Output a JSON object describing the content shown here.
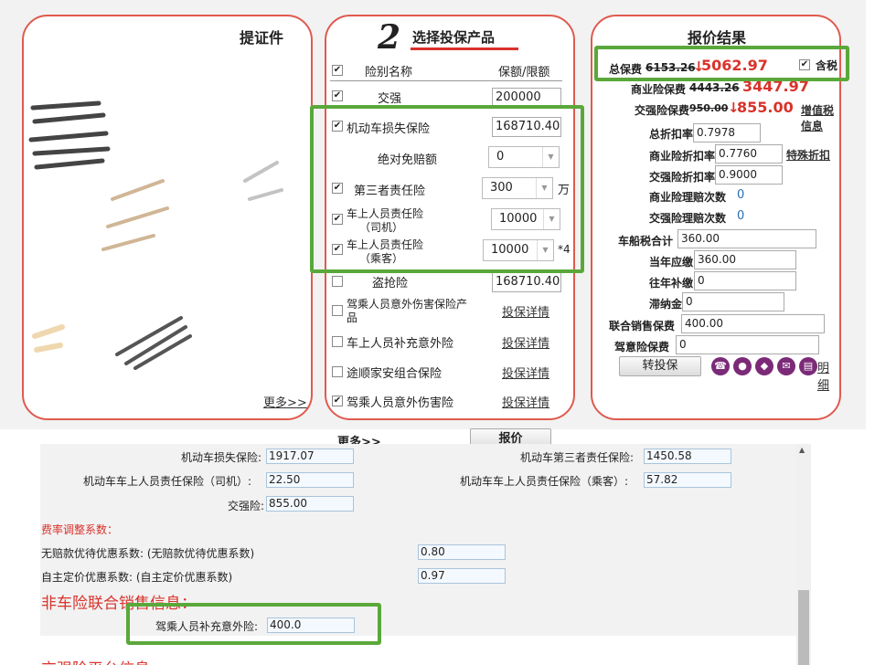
{
  "left_panel": {
    "title_fragment": "提证件",
    "more_link": "更多>>"
  },
  "middle_panel": {
    "step_number": "2",
    "title": "选择投保产品",
    "col_name": "险别名称",
    "col_amount": "保额/限额",
    "rows": [
      {
        "label": "交强",
        "value": "200000",
        "checked": true
      },
      {
        "label": "机动车损失保险",
        "value": "168710.40",
        "checked": true
      },
      {
        "label": "绝对免赔额",
        "value": "0"
      },
      {
        "label": "第三者责任险",
        "value": "300",
        "unit": "万",
        "checked": true
      },
      {
        "label": "车上人员责任险",
        "sub": "（司机）",
        "value": "10000",
        "checked": true
      },
      {
        "label": "车上人员责任险",
        "sub": "（乘客）",
        "value": "10000",
        "suffix": "*4",
        "checked": true
      },
      {
        "label": "盗抢险",
        "value": "168710.40",
        "checked": false
      },
      {
        "label": "驾乘人员意外伤害保险产",
        "label2": "品",
        "link": "投保详情",
        "checked": false
      },
      {
        "label": "车上人员补充意外险",
        "link": "投保详情",
        "checked": false
      },
      {
        "label": "途顺家安组合保险",
        "link": "投保详情",
        "checked": false
      },
      {
        "label": "驾乘人员意外伤害险",
        "link": "投保详情",
        "checked": true
      }
    ],
    "more_link": "更多>>",
    "quote_button": "报价"
  },
  "right_panel": {
    "title": "报价结果",
    "total_label": "总保费",
    "total_old": "6153.26",
    "total_new": "5062.97",
    "tax_label": "含税",
    "biz_label": "商业险保费",
    "biz_old": "4443.26",
    "biz_new": "3447.97",
    "cti_label": "交强险保费",
    "cti_old": "950.00",
    "cti_new": "855.00",
    "vat_link": "增值税信息",
    "total_discount_label": "总折扣率",
    "total_discount": "0.7978",
    "biz_discount_label": "商业险折扣率",
    "biz_discount": "0.7760",
    "special_discount_link": "特殊折扣",
    "cti_discount_label": "交强险折扣率",
    "cti_discount": "0.9000",
    "biz_claims_label": "商业险理赔次数",
    "biz_claims": "0",
    "cti_claims_label": "交强险理赔次数",
    "cti_claims": "0",
    "vessel_tax_label": "车船税合计",
    "vessel_tax": "360.00",
    "current_due_label": "当年应缴",
    "current_due": "360.00",
    "past_due_label": "往年补缴",
    "past_due": "0",
    "late_fee_label": "滞纳金",
    "late_fee": "0",
    "joint_sale_label": "联合销售保费",
    "joint_sale": "400.00",
    "driver_acc_label": "驾意险保费",
    "driver_acc": "0",
    "transfer_button": "转投保",
    "detail_link": "明细"
  },
  "detail": {
    "rows": [
      {
        "label": "机动车损失保险:",
        "value": "1917.07",
        "label_r": "机动车第三者责任保险:",
        "value_r": "1450.58"
      },
      {
        "label": "机动车车上人员责任保险（司机）:",
        "value": "22.50",
        "label_r": "机动车车上人员责任保险（乘客）:",
        "value_r": "57.82"
      },
      {
        "label": "交强险:",
        "value": "855.00"
      }
    ],
    "rate_title": "费率调整系数：",
    "rate_rows": [
      {
        "label": "无赔款优待优惠系数: (无赔款优待优惠系数)",
        "value": "0.80"
      },
      {
        "label": "自主定价优惠系数: (自主定价优惠系数)",
        "value": "0.97"
      }
    ],
    "non_car_title": "非车险联合销售信息：",
    "non_car_label": "驾乘人员补充意外险:",
    "non_car_value": "400.0",
    "bottom_cut": "交强险平台信息"
  }
}
